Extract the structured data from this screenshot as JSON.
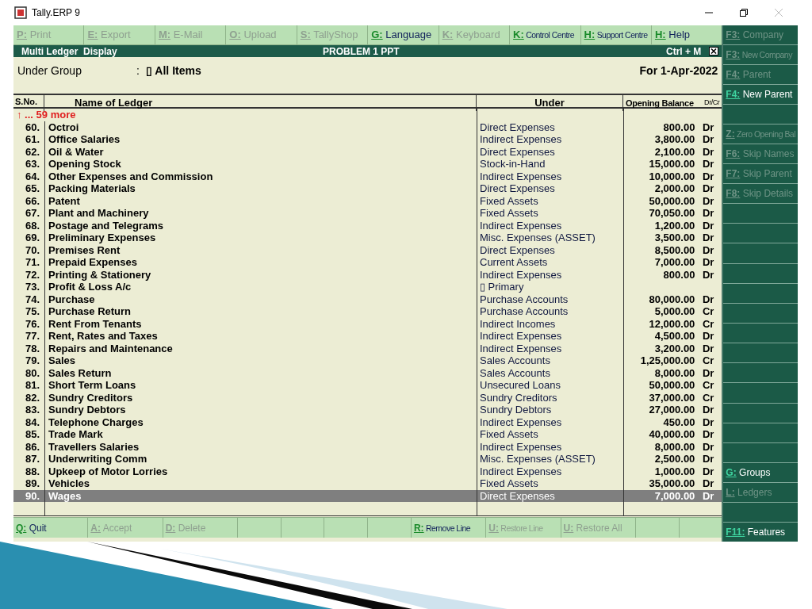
{
  "window": {
    "title": "Tally.ERP 9"
  },
  "top_buttons": [
    {
      "key": "P:",
      "label": "Print",
      "enabled": false
    },
    {
      "key": "E:",
      "label": "Export",
      "enabled": false
    },
    {
      "key": "M:",
      "label": "E-Mail",
      "enabled": false
    },
    {
      "key": "O:",
      "label": "Upload",
      "enabled": false
    },
    {
      "key": "S:",
      "label": "TallyShop",
      "enabled": false
    },
    {
      "key": "G:",
      "label": "Language",
      "enabled": true
    },
    {
      "key": "K:",
      "label": "Keyboard",
      "enabled": false
    },
    {
      "key": "K:",
      "label": "Control Centre",
      "enabled": true,
      "compact": true
    },
    {
      "key": "H:",
      "label": "Support Centre",
      "enabled": true,
      "compact": true
    },
    {
      "key": "H:",
      "label": "Help",
      "enabled": true
    }
  ],
  "title_bar": {
    "left": "Multi Ledger  Display",
    "center": "PROBLEM 1 PPT",
    "right": "Ctrl + M"
  },
  "header": {
    "label": "Under Group",
    "colon": ":",
    "value": "▯ All Items",
    "date": "For 1-Apr-2022"
  },
  "table": {
    "columns": [
      "S.No.",
      "Name of Ledger",
      "Under",
      "Opening Balance",
      "Dr/Cr"
    ],
    "more": "↑ ... 59 more",
    "rows": [
      {
        "no": "60.",
        "name": "Octroi",
        "under": "Direct Expenses",
        "amount": "800.00",
        "drcr": "Dr",
        "selected": false
      },
      {
        "no": "61.",
        "name": "Office Salaries",
        "under": "Indirect Expenses",
        "amount": "3,800.00",
        "drcr": "Dr",
        "selected": false
      },
      {
        "no": "62.",
        "name": "Oil & Water",
        "under": "Direct Expenses",
        "amount": "2,100.00",
        "drcr": "Dr",
        "selected": false
      },
      {
        "no": "63.",
        "name": "Opening Stock",
        "under": "Stock-in-Hand",
        "amount": "15,000.00",
        "drcr": "Dr",
        "selected": false
      },
      {
        "no": "64.",
        "name": "Other Expenses and Commission",
        "under": "Indirect Expenses",
        "amount": "10,000.00",
        "drcr": "Dr",
        "selected": false
      },
      {
        "no": "65.",
        "name": "Packing Materials",
        "under": "Direct Expenses",
        "amount": "2,000.00",
        "drcr": "Dr",
        "selected": false
      },
      {
        "no": "66.",
        "name": "Patent",
        "under": "Fixed Assets",
        "amount": "50,000.00",
        "drcr": "Dr",
        "selected": false
      },
      {
        "no": "67.",
        "name": "Plant and Machinery",
        "under": "Fixed Assets",
        "amount": "70,050.00",
        "drcr": "Dr",
        "selected": false
      },
      {
        "no": "68.",
        "name": "Postage and Telegrams",
        "under": "Indirect Expenses",
        "amount": "1,200.00",
        "drcr": "Dr",
        "selected": false
      },
      {
        "no": "69.",
        "name": "Preliminary Expenses",
        "under": "Misc. Expenses (ASSET)",
        "amount": "3,500.00",
        "drcr": "Dr",
        "selected": false
      },
      {
        "no": "70.",
        "name": "Premises Rent",
        "under": "Direct Expenses",
        "amount": "8,500.00",
        "drcr": "Dr",
        "selected": false
      },
      {
        "no": "71.",
        "name": "Prepaid Expenses",
        "under": "Current Assets",
        "amount": "7,000.00",
        "drcr": "Dr",
        "selected": false
      },
      {
        "no": "72.",
        "name": "Printing & Stationery",
        "under": "Indirect Expenses",
        "amount": "800.00",
        "drcr": "Dr",
        "selected": false
      },
      {
        "no": "73.",
        "name": "Profit & Loss A/c",
        "under": "▯ Primary",
        "selected": false
      },
      {
        "no": "74.",
        "name": "Purchase",
        "under": "Purchase Accounts",
        "amount": "80,000.00",
        "drcr": "Dr",
        "selected": false
      },
      {
        "no": "75.",
        "name": "Purchase Return",
        "under": "Purchase Accounts",
        "amount": "5,000.00",
        "drcr": "Cr",
        "selected": false
      },
      {
        "no": "76.",
        "name": "Rent From Tenants",
        "under": "Indirect Incomes",
        "amount": "12,000.00",
        "drcr": "Cr",
        "selected": false
      },
      {
        "no": "77.",
        "name": "Rent, Rates and Taxes",
        "under": "Indirect Expenses",
        "amount": "4,500.00",
        "drcr": "Dr",
        "selected": false
      },
      {
        "no": "78.",
        "name": "Repairs and Maintenance",
        "under": "Indirect Expenses",
        "amount": "3,200.00",
        "drcr": "Dr",
        "selected": false
      },
      {
        "no": "79.",
        "name": "Sales",
        "under": "Sales Accounts",
        "amount": "1,25,000.00",
        "drcr": "Cr",
        "selected": false
      },
      {
        "no": "80.",
        "name": "Sales Return",
        "under": "Sales Accounts",
        "amount": "8,000.00",
        "drcr": "Dr",
        "selected": false
      },
      {
        "no": "81.",
        "name": "Short Term Loans",
        "under": "Unsecured Loans",
        "amount": "50,000.00",
        "drcr": "Cr",
        "selected": false
      },
      {
        "no": "82.",
        "name": "Sundry Creditors",
        "under": "Sundry Creditors",
        "amount": "37,000.00",
        "drcr": "Cr",
        "selected": false
      },
      {
        "no": "83.",
        "name": "Sundry Debtors",
        "under": "Sundry Debtors",
        "amount": "27,000.00",
        "drcr": "Dr",
        "selected": false
      },
      {
        "no": "84.",
        "name": "Telephone Charges",
        "under": "Indirect Expenses",
        "amount": "450.00",
        "drcr": "Dr",
        "selected": false
      },
      {
        "no": "85.",
        "name": "Trade Mark",
        "under": "Fixed Assets",
        "amount": "40,000.00",
        "drcr": "Dr",
        "selected": false
      },
      {
        "no": "86.",
        "name": "Travellers Salaries",
        "under": "Indirect Expenses",
        "amount": "8,000.00",
        "drcr": "Dr",
        "selected": false
      },
      {
        "no": "87.",
        "name": "Underwriting Comm",
        "under": "Misc. Expenses (ASSET)",
        "amount": "2,500.00",
        "drcr": "Dr",
        "selected": false
      },
      {
        "no": "88.",
        "name": "Upkeep of Motor Lorries",
        "under": "Indirect Expenses",
        "amount": "1,000.00",
        "drcr": "Dr",
        "selected": false
      },
      {
        "no": "89.",
        "name": "Vehicles",
        "under": "Fixed Assets",
        "amount": "35,000.00",
        "drcr": "Dr",
        "selected": false
      },
      {
        "no": "90.",
        "name": "Wages",
        "under": "Direct Expenses",
        "amount": "7,000.00",
        "drcr": "Dr",
        "selected": true
      }
    ]
  },
  "bottom_buttons": [
    {
      "kind": "key",
      "key": "Q:",
      "label": "Quit",
      "enabled": true
    },
    {
      "kind": "key",
      "key": "A:",
      "label": "Accept",
      "enabled": false
    },
    {
      "kind": "key",
      "key": "D:",
      "label": "Delete",
      "enabled": false
    },
    {
      "kind": "blank"
    },
    {
      "kind": "blank"
    },
    {
      "kind": "blank"
    },
    {
      "kind": "blank"
    },
    {
      "kind": "key",
      "key": "R:",
      "label": "Remove Line",
      "enabled": true,
      "compact": true
    },
    {
      "kind": "key",
      "key": "U:",
      "label": "Restore Line",
      "enabled": false,
      "compact": true
    },
    {
      "kind": "key",
      "key": "U:",
      "label": "Restore All",
      "enabled": false
    },
    {
      "kind": "blank"
    },
    {
      "kind": "blank"
    }
  ],
  "side_buttons": [
    {
      "kind": "key",
      "key": "F3:",
      "label": "Company",
      "enabled": false
    },
    {
      "kind": "key",
      "key": "F3:",
      "label": "New Company",
      "enabled": false,
      "compact": true
    },
    {
      "kind": "key",
      "key": "F4:",
      "label": "Parent",
      "enabled": false
    },
    {
      "kind": "key",
      "key": "F4:",
      "label": "New Parent",
      "enabled": true
    },
    {
      "kind": "blank"
    },
    {
      "kind": "key",
      "key": "Z:",
      "label": "Zero Opening Bal",
      "enabled": false,
      "compact": true
    },
    {
      "kind": "key",
      "key": "F6:",
      "label": "Skip Names",
      "enabled": false
    },
    {
      "kind": "key",
      "key": "F7:",
      "label": "Skip Parent",
      "enabled": false
    },
    {
      "kind": "key",
      "key": "F8:",
      "label": "Skip Details",
      "enabled": false
    },
    {
      "kind": "blank"
    },
    {
      "kind": "blank"
    },
    {
      "kind": "blank"
    },
    {
      "kind": "blank"
    },
    {
      "kind": "blank"
    },
    {
      "kind": "blank"
    },
    {
      "kind": "blank"
    },
    {
      "kind": "blank"
    },
    {
      "kind": "blank"
    },
    {
      "kind": "blank"
    },
    {
      "kind": "blank"
    },
    {
      "kind": "blank"
    },
    {
      "kind": "blank"
    },
    {
      "kind": "key",
      "key": "G:",
      "label": "Groups",
      "enabled": true
    },
    {
      "kind": "key",
      "key": "L:",
      "label": "Ledgers",
      "enabled": false
    },
    {
      "kind": "blank"
    },
    {
      "kind": "key",
      "key": "F11:",
      "label": "Features",
      "enabled": true
    }
  ]
}
